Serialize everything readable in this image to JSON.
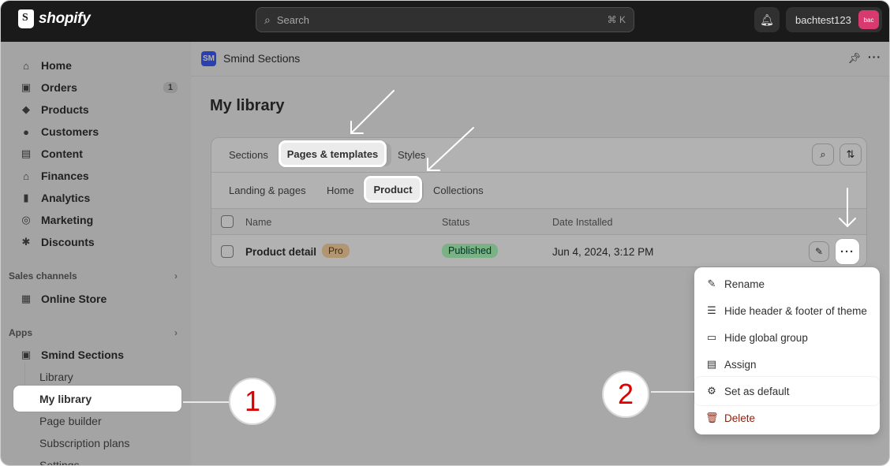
{
  "topbar": {
    "logo_text": "shopify",
    "search_placeholder": "Search",
    "search_shortcut": "⌘ K",
    "account_name": "bachtest123",
    "avatar_text": "bac"
  },
  "sidebar": {
    "items": [
      {
        "label": "Home",
        "icon": "home-icon",
        "glyph": "⌂"
      },
      {
        "label": "Orders",
        "icon": "orders-icon",
        "glyph": "▣",
        "badge": "1"
      },
      {
        "label": "Products",
        "icon": "tag-icon",
        "glyph": "◆"
      },
      {
        "label": "Customers",
        "icon": "person-icon",
        "glyph": "●"
      },
      {
        "label": "Content",
        "icon": "content-icon",
        "glyph": "▤"
      },
      {
        "label": "Finances",
        "icon": "bank-icon",
        "glyph": "⌂"
      },
      {
        "label": "Analytics",
        "icon": "chart-icon",
        "glyph": "▮"
      },
      {
        "label": "Marketing",
        "icon": "target-icon",
        "glyph": "◎"
      },
      {
        "label": "Discounts",
        "icon": "discount-icon",
        "glyph": "✱"
      }
    ],
    "sales_channels_label": "Sales channels",
    "online_store_label": "Online Store",
    "apps_label": "Apps",
    "app_name": "Smind Sections",
    "sub_items": [
      "Library",
      "My library",
      "Page builder",
      "Subscription plans",
      "Settings"
    ]
  },
  "app_bar": {
    "icon_text": "SM",
    "title": "Smind Sections"
  },
  "page": {
    "title": "My library"
  },
  "tabs_primary": [
    "Sections",
    "Pages & templates",
    "Styles"
  ],
  "tabs_secondary": [
    "Landing & pages",
    "Home",
    "Product",
    "Collections"
  ],
  "table": {
    "headers": [
      "Name",
      "Status",
      "Date Installed"
    ],
    "rows": [
      {
        "name": "Product detail",
        "badge": "Pro",
        "status": "Published",
        "date": "Jun 4, 2024, 3:12 PM"
      }
    ]
  },
  "menu": {
    "items": [
      {
        "label": "Rename",
        "icon": "edit-icon",
        "glyph": "✎"
      },
      {
        "label": "Hide header & footer of theme",
        "icon": "layout-icon",
        "glyph": "☰"
      },
      {
        "label": "Hide global group",
        "icon": "folder-icon",
        "glyph": "▭"
      },
      {
        "label": "Assign",
        "icon": "assign-icon",
        "glyph": "▤"
      },
      {
        "label": "Set as default",
        "icon": "settings-icon",
        "glyph": "⚙"
      },
      {
        "label": "Delete",
        "icon": "trash-icon",
        "glyph": "🗑"
      }
    ]
  },
  "callouts": [
    "1",
    "2"
  ]
}
